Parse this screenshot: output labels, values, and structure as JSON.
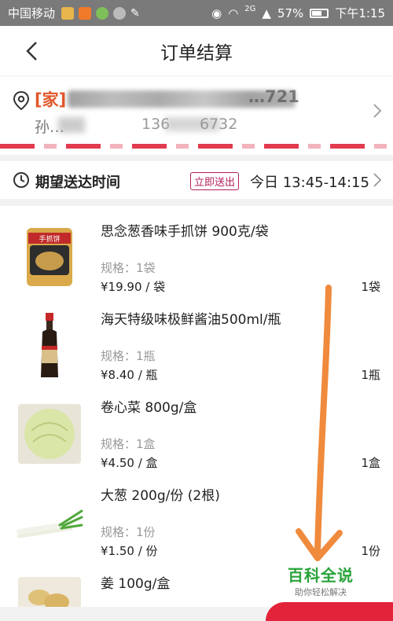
{
  "statusbar": {
    "carrier": "中国移动",
    "signal": "2G",
    "battery": "57%",
    "time": "下午1:15"
  },
  "navbar": {
    "title": "订单结算"
  },
  "address": {
    "tag": "[家]",
    "address_tail": "…721",
    "name": "孙…",
    "phone_head": "136",
    "phone_tail": "6732"
  },
  "delivery": {
    "label": "期望送达时间",
    "badge": "立即送出",
    "time": "今日 13:45-14:15"
  },
  "items": [
    {
      "name": "思念葱香味手抓饼 900克/袋",
      "spec": "规格：1袋",
      "price": "¥19.90 / 袋",
      "qty": "1袋",
      "icon": "flatbread-bag-image"
    },
    {
      "name": "海天特级味极鲜酱油500ml/瓶",
      "spec": "规格：1瓶",
      "price": "¥8.40 / 瓶",
      "qty": "1瓶",
      "icon": "soy-sauce-bottle-image"
    },
    {
      "name": "卷心菜 800g/盒",
      "spec": "规格：1盒",
      "price": "¥4.50 / 盒",
      "qty": "1盒",
      "icon": "cabbage-image"
    },
    {
      "name": "大葱 200g/份 (2根)",
      "spec": "规格：1份",
      "price": "¥1.50 / 份",
      "qty": "1份",
      "icon": "scallion-image"
    },
    {
      "name": "姜 100g/盒",
      "spec": "",
      "price": "",
      "qty": "",
      "icon": "ginger-image"
    }
  ],
  "watermark": {
    "title": "百科全说",
    "subtitle": "助你轻松解决"
  },
  "colors": {
    "accent": "#e2233a",
    "badge": "#b21f5c",
    "tag": "#e2572b",
    "annotation": "#f08a3c"
  }
}
